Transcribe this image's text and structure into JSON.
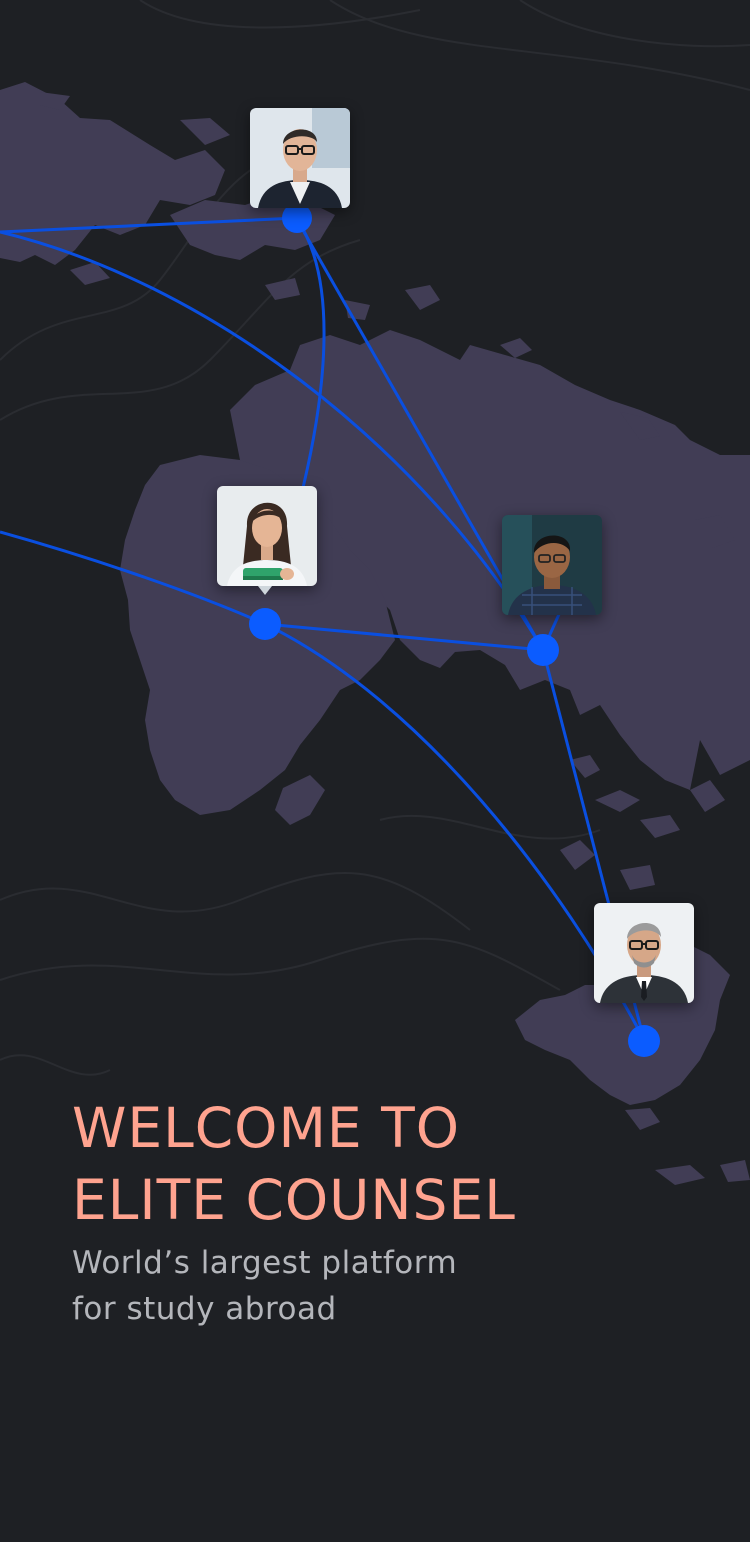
{
  "app": {
    "headline_line1": "WELCOME TO",
    "headline_line2": "ELITE COUNSEL",
    "subtitle_line1": "World’s largest platform",
    "subtitle_line2": "for study abroad"
  },
  "colors": {
    "background": "#1e2024",
    "landmass": "#413d55",
    "route_line": "#0a4fe0",
    "node": "#0b5cff",
    "headline": "#ffa38f",
    "subtitle": "#b4b6bb"
  },
  "map": {
    "counsellors": [
      {
        "id": "europe",
        "icon": "man-glasses-portrait-icon"
      },
      {
        "id": "africa",
        "icon": "woman-student-portrait-icon"
      },
      {
        "id": "asia",
        "icon": "man-portrait-icon"
      },
      {
        "id": "australia",
        "icon": "older-man-glasses-portrait-icon"
      }
    ]
  }
}
